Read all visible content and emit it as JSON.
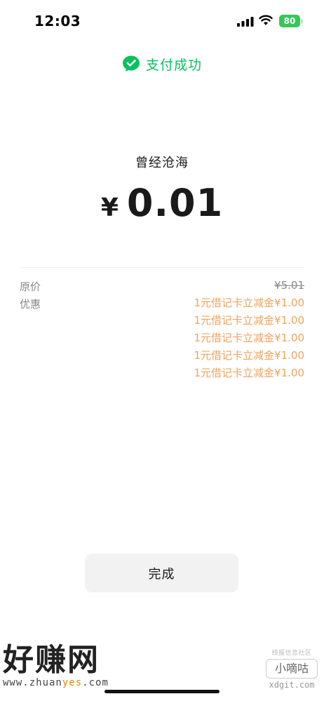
{
  "status_bar": {
    "time": "12:03",
    "battery": "80"
  },
  "header": {
    "title": "支付成功",
    "icon": "wechat-pay-icon",
    "accent": "#07c160"
  },
  "payment": {
    "merchant": "曾经沧海",
    "currency": "¥",
    "amount": "0.01"
  },
  "details": {
    "original_price_label": "原价",
    "original_price": "¥5.01",
    "discount_label": "优惠",
    "discount_color": "#f0a35e",
    "discounts": [
      "1元借记卡立减金¥1.00",
      "1元借记卡立减金¥1.00",
      "1元借记卡立减金¥1.00",
      "1元借记卡立减金¥1.00",
      "1元借记卡立减金¥1.00"
    ]
  },
  "actions": {
    "done_label": "完成"
  },
  "watermarks": {
    "left_title": "好赚网",
    "left_url_pre": "www.zhuan",
    "left_url_hl": "yes",
    "left_url_post": ".com",
    "right_top": "线报信息社区",
    "right_badge": "小嘀咕",
    "right_url": "xdgit.com"
  }
}
